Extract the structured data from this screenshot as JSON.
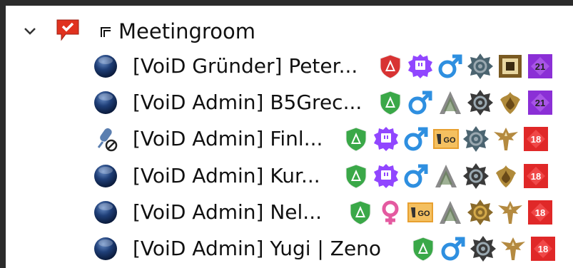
{
  "channel": {
    "name": "Meetingroom",
    "expanded": true
  },
  "users": [
    {
      "name": "[VoiD Gründer] Peter...",
      "status": "talk-off",
      "badges": [
        "admin-shield-red",
        "twitch-badge",
        "male-gender",
        "overwatch-rank-silver",
        "square-badge-bronze",
        "age-21-purple"
      ]
    },
    {
      "name": "[VoiD Admin] B5Grec...",
      "status": "talk-off",
      "badges": [
        "admin-shield-green",
        "male-gender",
        "ark-logo",
        "overwatch-rank-dark",
        "hearthstone-rank",
        "age-21-purple"
      ]
    },
    {
      "name": "[VoiD Admin] Finl...",
      "status": "muted-mic",
      "badges": [
        "admin-shield-green",
        "twitch-badge",
        "male-gender",
        "csgo-badge",
        "overwatch-rank-silver",
        "winged-emblem",
        "age-18-red"
      ]
    },
    {
      "name": "[VoiD Admin] Kur...",
      "status": "talk-off",
      "badges": [
        "admin-shield-green",
        "twitch-badge",
        "male-gender",
        "ark-logo",
        "overwatch-rank-dark",
        "hearthstone-rank",
        "age-18-red"
      ]
    },
    {
      "name": "[VoiD Admin] Nel...",
      "status": "talk-off",
      "badges": [
        "admin-shield-green",
        "female-gender",
        "csgo-badge",
        "ark-logo",
        "overwatch-rank-gold",
        "winged-emblem",
        "age-18-red"
      ]
    },
    {
      "name": "[VoiD Admin] Yugi | Zeno",
      "status": "talk-off",
      "badges": [
        "admin-shield-green",
        "male-gender",
        "overwatch-rank-dark",
        "winged-emblem",
        "age-18-red"
      ]
    }
  ],
  "badge_labels": {
    "csgo": "GO",
    "age21": "21",
    "age18": "18"
  },
  "colors": {
    "twitch": "#9146ff",
    "shield_green": "#3aa848",
    "shield_red": "#d83333",
    "male": "#2e8fe0",
    "female": "#e45aa0",
    "age21": "#8b2fd6",
    "age18": "#e02828"
  }
}
